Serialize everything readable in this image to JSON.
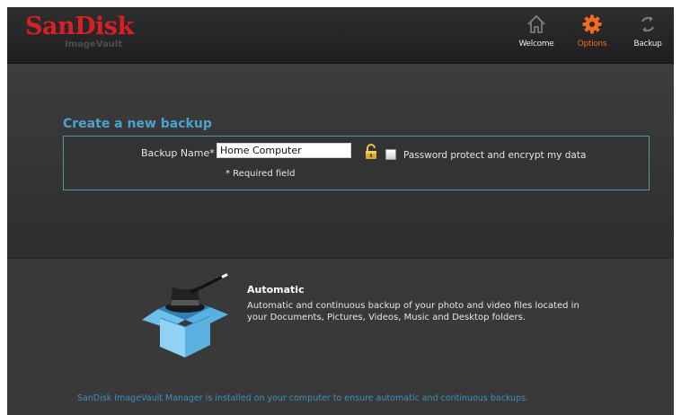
{
  "logo": {
    "brand": "SanDisk",
    "product": "ImageVault"
  },
  "nav": {
    "items": [
      {
        "label": "Welcome",
        "icon": "home-icon",
        "active": false
      },
      {
        "label": "Options",
        "icon": "gear-icon",
        "active": true
      },
      {
        "label": "Backup",
        "icon": "backup-icon",
        "active": false
      }
    ]
  },
  "form": {
    "title": "Create a new backup",
    "name_label": "Backup Name*",
    "name_value": "Home Computer",
    "password_label": "Password protect and encrypt my data",
    "password_checked": false,
    "required_note": "* Required field"
  },
  "info": {
    "title": "Automatic",
    "text": "Automatic and continuous backup of your photo and video files located in your Documents, Pictures, Videos, Music and Desktop folders."
  },
  "footer": {
    "text": "SanDisk ImageVault Manager is installed on your computer to ensure automatic and continuous backups."
  },
  "colors": {
    "brand_red": "#d71f26",
    "accent_orange": "#f26a21",
    "title_blue": "#4aa3cf",
    "footer_blue": "#3e91bd"
  }
}
